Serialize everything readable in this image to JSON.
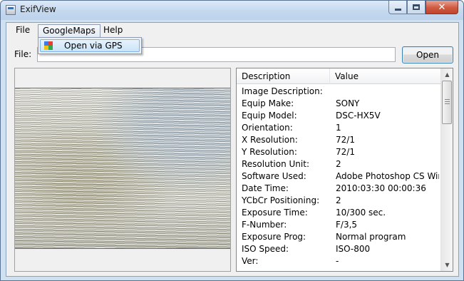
{
  "window": {
    "title": "ExifView"
  },
  "menu": {
    "file": "File",
    "googlemaps": "GoogleMaps",
    "help": "Help",
    "dropdown_item": "Open via GPS"
  },
  "file_row": {
    "label": "File:",
    "value": "",
    "open_button": "Open"
  },
  "table": {
    "columns": [
      "Description",
      "Value"
    ],
    "rows": [
      {
        "description": "Image Description:",
        "value": ""
      },
      {
        "description": "Equip Make:",
        "value": "SONY"
      },
      {
        "description": "Equip Model:",
        "value": "DSC-HX5V"
      },
      {
        "description": "Orientation:",
        "value": "1"
      },
      {
        "description": "X Resolution:",
        "value": "72/1"
      },
      {
        "description": "Y Resolution:",
        "value": "72/1"
      },
      {
        "description": "Resolution Unit:",
        "value": "2"
      },
      {
        "description": "Software Used:",
        "value": "Adobe Photoshop CS Win..."
      },
      {
        "description": "Date Time:",
        "value": "2010:03:30 00:00:36"
      },
      {
        "description": "YCbCr Positioning:",
        "value": "2"
      },
      {
        "description": "Exposure Time:",
        "value": "10/300 sec."
      },
      {
        "description": "F-Number:",
        "value": "F/3,5"
      },
      {
        "description": "Exposure Prog:",
        "value": "Normal program"
      },
      {
        "description": "ISO Speed:",
        "value": "ISO-800"
      },
      {
        "description": "Ver:",
        "value": "-"
      }
    ]
  },
  "colors": {
    "selection": "#cbe4f8",
    "window_frame": "#cfe0f1",
    "close_button": "#cf5a40"
  },
  "icons": [
    "app-icon",
    "minimize-icon",
    "maximize-icon",
    "close-icon",
    "googlemaps-icon",
    "scroll-up-icon",
    "scroll-down-icon"
  ]
}
